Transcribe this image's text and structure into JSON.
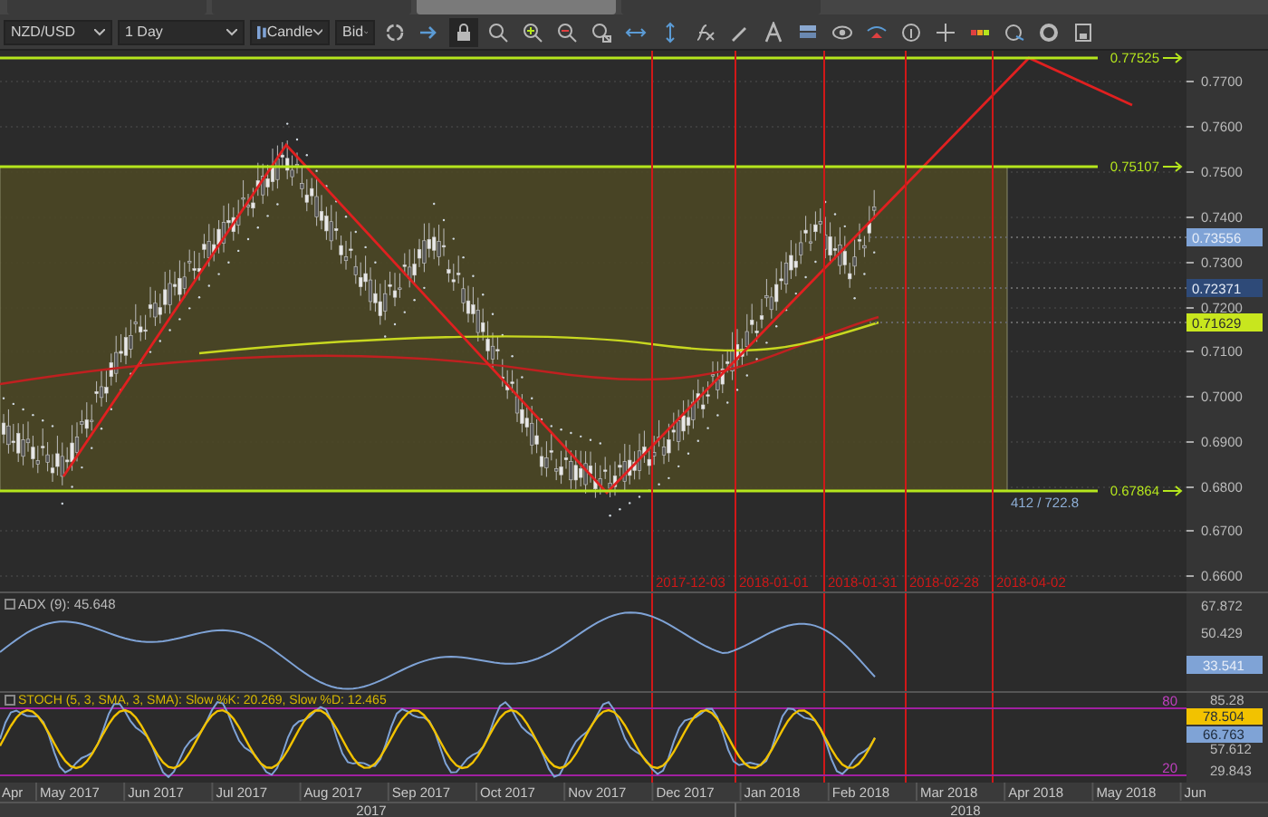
{
  "tabs": [
    {
      "selected": false
    },
    {
      "selected": false
    },
    {
      "selected": true
    },
    {
      "selected": false
    }
  ],
  "toolbar": {
    "symbol": "NZD/USD",
    "timeframe": "1 Day",
    "chart_type": "Candle",
    "price_side": "Bid"
  },
  "price_axis": {
    "ticks": [
      "0.7700",
      "0.7600",
      "0.7500",
      "0.7400",
      "0.7300",
      "0.7200",
      "0.7100",
      "0.7000",
      "0.6900",
      "0.6800",
      "0.6700",
      "0.6600"
    ]
  },
  "levels": [
    {
      "label": "0.77525"
    },
    {
      "label": "0.75107"
    },
    {
      "label": "0.67864"
    }
  ],
  "price_tags": [
    {
      "value": "0.73556",
      "color": "#7fa3d6"
    },
    {
      "value": "0.72371",
      "color": "#2e4a78"
    },
    {
      "value": "0.71629",
      "color": "#c8e61e"
    }
  ],
  "range_label": "412 / 722.8",
  "date_markers": [
    "2017-12-03",
    "2018-01-01",
    "2018-01-31",
    "2018-02-28",
    "2018-04-02"
  ],
  "adx": {
    "checked": false,
    "legend": "ADX (9): 45.648",
    "ticks": [
      "67.872",
      "50.429"
    ],
    "tag": "33.541"
  },
  "stoch": {
    "checked": false,
    "legend": "STOCH (5, 3, SMA, 3, SMA): Slow %K: 20.269, Slow %D: 12.465",
    "ticks": [
      "85.28",
      "57.612",
      "29.843"
    ],
    "bands": [
      "80",
      "20"
    ],
    "tags": [
      {
        "value": "78.504",
        "color": "#f2c200"
      },
      {
        "value": "66.763",
        "color": "#7fa3d6"
      }
    ]
  },
  "time_axis": {
    "months": [
      "Apr",
      "May 2017",
      "Jun 2017",
      "Jul 2017",
      "Aug 2017",
      "Sep 2017",
      "Oct 2017",
      "Nov 2017",
      "Dec 2017",
      "Jan 2018",
      "Feb 2018",
      "Mar 2018",
      "Apr 2018",
      "May 2018",
      "Jun"
    ],
    "years": [
      "2017",
      "2018"
    ]
  }
}
